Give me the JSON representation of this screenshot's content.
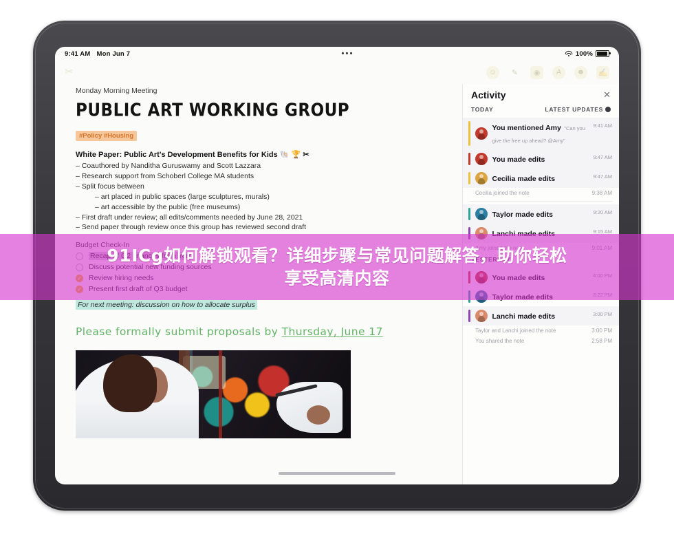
{
  "banner": {
    "line1": "91ICg如何解锁观看？详细步骤与常见问题解答，助你轻松",
    "line2": "享受高清内容",
    "color": "#d534cd"
  },
  "device": {
    "statusbar": {
      "time": "9:41 AM",
      "date": "Mon Jun 7",
      "dots": "•••",
      "wifi_icon": "wifi-icon",
      "battery_label": "100%",
      "battery_icon": "battery-icon"
    },
    "appbar": {
      "brand_icon": "scissors-icon",
      "tools": [
        {
          "icon": "share-person-icon",
          "glyph": "☺"
        },
        {
          "icon": "pen-tool-icon",
          "glyph": "✎"
        },
        {
          "icon": "camera-icon",
          "glyph": "◎"
        },
        {
          "icon": "draw-circle-icon",
          "glyph": "A"
        },
        {
          "icon": "sticker-icon",
          "glyph": "☻"
        },
        {
          "icon": "compose-icon",
          "glyph": "✍"
        }
      ]
    },
    "home_indicator": "home-indicator"
  },
  "document": {
    "subtitle": "Monday Morning Meeting",
    "title": "PUBLIC ART WORKING GROUP",
    "tags": "#Policy #Housing",
    "heading": "White Paper: Public Art's Development Benefits for Kids 🐚 🏆 ✂",
    "bullets": [
      {
        "text": "– Coauthored by Nanditha Guruswamy and Scott Lazzara",
        "indent": false
      },
      {
        "text": "– Research support from Schoberl College MA students",
        "indent": false
      },
      {
        "text": "– Split focus between",
        "indent": false
      },
      {
        "text": "– art placed in public spaces (large sculptures, murals)",
        "indent": true
      },
      {
        "text": "– art accessible by the public (free museums)",
        "indent": true
      },
      {
        "text": "– First draft under review; all edits/comments needed by June 28, 2021",
        "indent": false
      },
      {
        "text": "– Send paper through review once this group has reviewed second draft",
        "indent": false
      }
    ],
    "section_label": "Budget Check-In",
    "checklist": [
      {
        "label": "Recap of Q2 finances from Yen",
        "done": false,
        "highlight": true
      },
      {
        "label": "Discuss potential new funding sources",
        "done": false,
        "highlight": false
      },
      {
        "label": "Review hiring needs",
        "done": true,
        "highlight": false
      },
      {
        "label": "Present first draft of Q3 budget",
        "done": true,
        "highlight": false
      }
    ],
    "footnote": "For next meeting: discussion on how to allocate surplus",
    "handwriting_prefix": "Please formally submit proposals by ",
    "handwriting_underlined": "Thursday, June 17",
    "photo_name": "mural-painting-photo"
  },
  "activity": {
    "title": "Activity",
    "close_icon": "close-icon",
    "section_today": "TODAY",
    "filter_label": "LATEST UPDATES",
    "filter_icon": "gear-icon",
    "section_yesterday": "YESTERDAY",
    "events": [
      {
        "title": "You mentioned Amy",
        "preview": "\"Can you give the free up ahead? @Amy\"",
        "time": "9:41 AM",
        "bar": "#e8c33a",
        "avatar": "#c0392b",
        "card": true
      },
      {
        "title": "You made edits",
        "preview": "",
        "time": "9:47 AM",
        "bar": "#c0392b",
        "avatar": "#c0392b",
        "card": true
      },
      {
        "title": "Cecilia made edits",
        "preview": "",
        "time": "9:47 AM",
        "bar": "#e8c33a",
        "avatar": "#d9a441",
        "card": true
      }
    ],
    "sys1": {
      "text": "Cecilia joined the note",
      "time": "9:38 AM"
    },
    "events2": [
      {
        "title": "Taylor made edits",
        "preview": "",
        "time": "9:20 AM",
        "bar": "#2aa39a",
        "avatar": "#2a7fa3",
        "card": true
      },
      {
        "title": "Lanchi made edits",
        "preview": "",
        "time": "9:15 AM",
        "bar": "#8e44ad",
        "avatar": "#d98a6a",
        "card": true
      }
    ],
    "sys2": {
      "text": "Amy joined the note",
      "time": "9:01 AM"
    },
    "events3": [
      {
        "title": "You made edits",
        "preview": "",
        "time": "4:00 PM",
        "bar": "#c0392b",
        "avatar": "#c0392b",
        "card": false
      },
      {
        "title": "Taylor made edits",
        "preview": "",
        "time": "3:22 PM",
        "bar": "#2aa39a",
        "avatar": "#2a7fa3",
        "card": false
      },
      {
        "title": "Lanchi made edits",
        "preview": "",
        "time": "3:00 PM",
        "bar": "#8e44ad",
        "avatar": "#d98a6a",
        "card": true
      }
    ],
    "sys3": {
      "text": "Taylor and Lanchi joined the note",
      "time": "3:00 PM"
    },
    "sys4": {
      "text": "You shared the note",
      "time": "2:58 PM"
    }
  }
}
